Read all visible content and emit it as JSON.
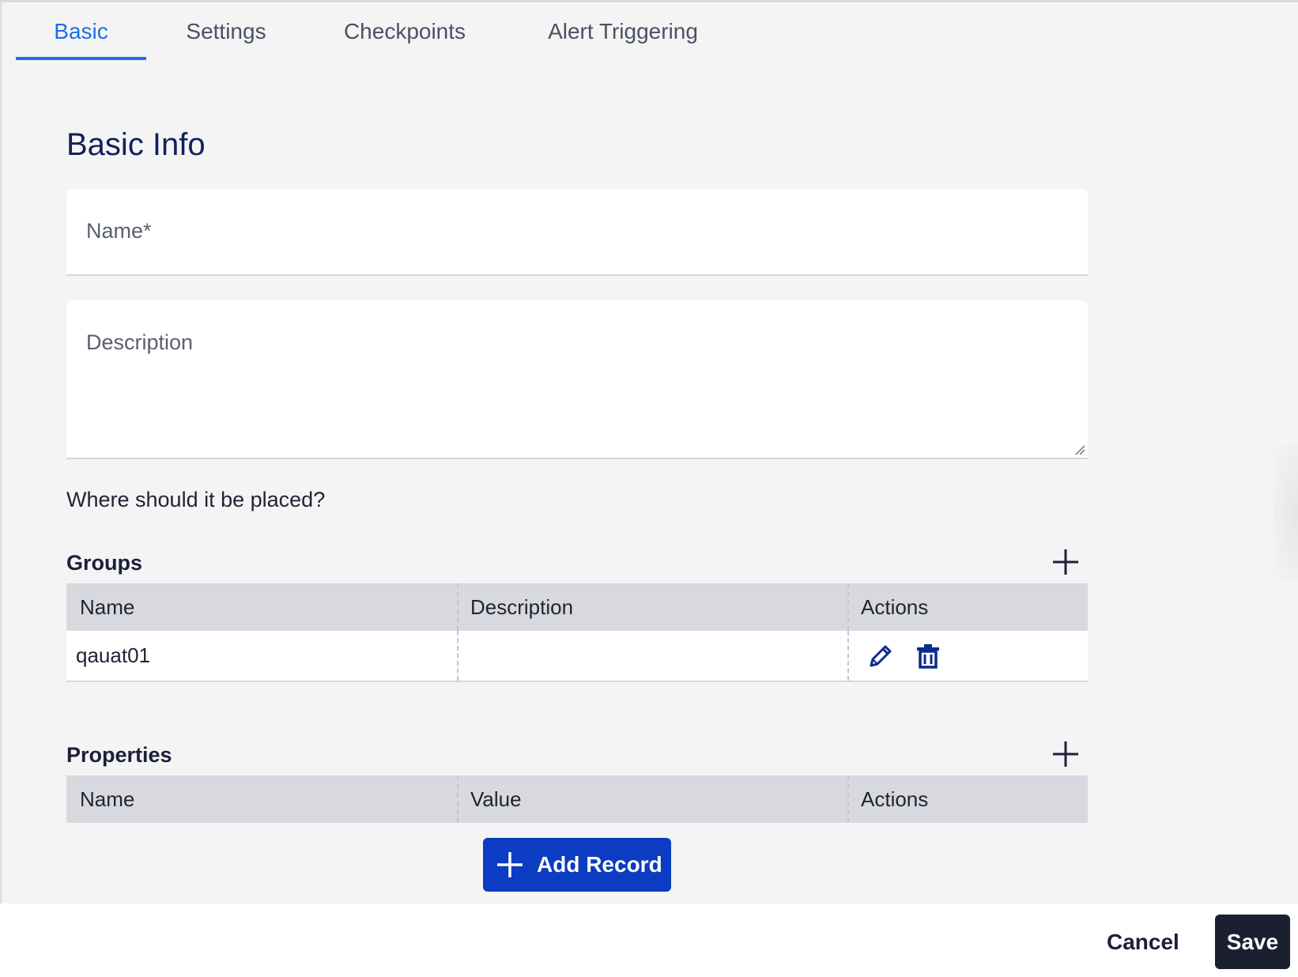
{
  "tabs": [
    {
      "label": "Basic",
      "active": true
    },
    {
      "label": "Settings",
      "active": false
    },
    {
      "label": "Checkpoints",
      "active": false
    },
    {
      "label": "Alert Triggering",
      "active": false
    }
  ],
  "basic_info": {
    "title": "Basic Info",
    "name_field": {
      "label": "Name*",
      "value": ""
    },
    "description_field": {
      "label": "Description",
      "value": ""
    },
    "placement_question": "Where should it be placed?"
  },
  "groups": {
    "title": "Groups",
    "columns": [
      "Name",
      "Description",
      "Actions"
    ],
    "rows": [
      {
        "name": "qauat01",
        "description": ""
      }
    ],
    "row_actions": [
      "pencil-icon",
      "trash-icon"
    ]
  },
  "properties": {
    "title": "Properties",
    "columns": [
      "Name",
      "Value",
      "Actions"
    ],
    "add_record_label": "Add Record"
  },
  "footer": {
    "cancel_label": "Cancel",
    "save_label": "Save"
  },
  "colors": {
    "accent_blue": "#1c6fe8",
    "primary_button": "#0b3cc1",
    "save_button": "#1a2030",
    "title_navy": "#13205a"
  }
}
